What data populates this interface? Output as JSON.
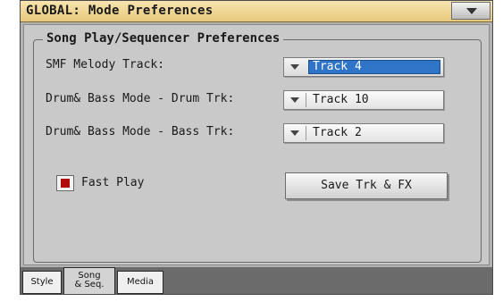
{
  "window": {
    "title": "GLOBAL: Mode Preferences",
    "menu_icon": "triangle-down-icon"
  },
  "group": {
    "title": "Song Play/Sequencer Preferences"
  },
  "fields": [
    {
      "label": "SMF Melody Track:",
      "value": "Track 4",
      "selected": true
    },
    {
      "label": "Drum& Bass Mode - Drum Trk:",
      "value": "Track 10",
      "selected": false
    },
    {
      "label": "Drum& Bass Mode - Bass Trk:",
      "value": "Track 2",
      "selected": false
    }
  ],
  "fast_play": {
    "label": "Fast Play",
    "checked": true,
    "check_color": "#b00c0c"
  },
  "save_button": {
    "label": "Save Trk & FX"
  },
  "tabs": [
    {
      "label": "Style",
      "active": false
    },
    {
      "label_line1": "Song",
      "label_line2": "& Seq.",
      "active": true
    },
    {
      "label": "Media",
      "active": false
    }
  ],
  "colors": {
    "titlebar": "#e8c97a",
    "panel": "#c9c9c9",
    "selection": "#2f74c6",
    "tabbar": "#6b6b6b"
  }
}
